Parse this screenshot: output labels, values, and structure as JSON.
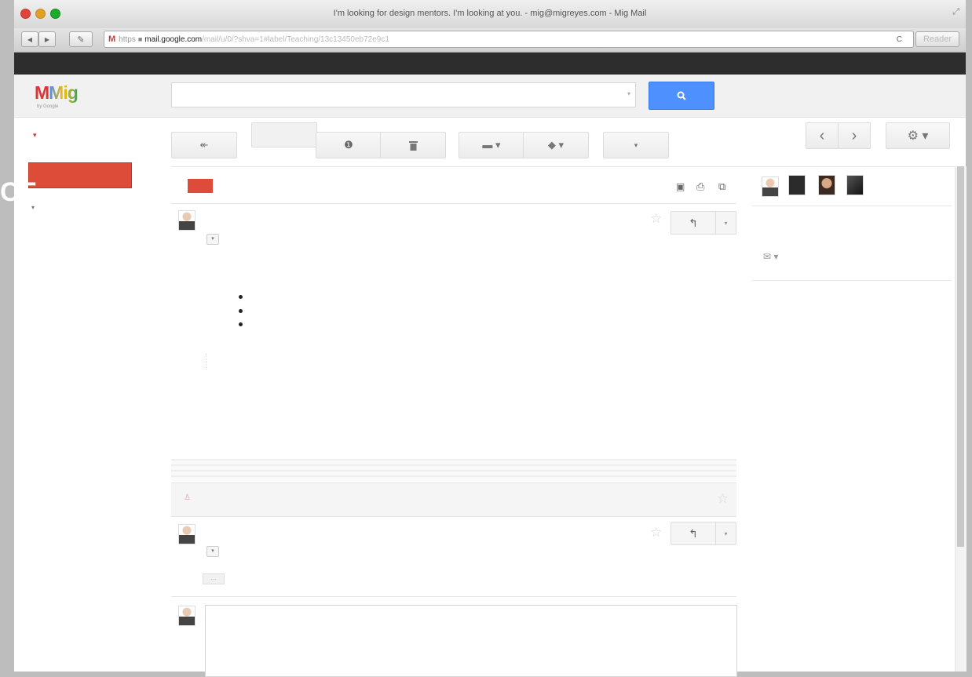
{
  "window": {
    "title": "I'm looking for design mentors. I'm looking at you. - mig@migreyes.com - Mig Mail",
    "traffic_colors": [
      "#e0443e",
      "#dea123",
      "#1aab29"
    ]
  },
  "browser": {
    "favicon": "M",
    "scheme": "https",
    "domain": "mail.google.com",
    "path": "/mail/u/0/?shva=1#label/Teaching/13c13450eb72e9c1",
    "reader_label": "Reader",
    "back_icon": "◀",
    "forward_icon": "▶",
    "wrench_icon": "🔧",
    "reload_icon": "C"
  },
  "gmail": {
    "logo_m": "M",
    "logo_name": "Mig",
    "logo_sub": "by Google",
    "accent": "#dd4b39",
    "search_icon": "🔍",
    "toolbar": {
      "back_icon": "↞",
      "spam_icon": "❶",
      "delete_icon": "🗑",
      "move_icon": "▬ ▾",
      "labels_icon": "◆ ▾",
      "more_icon": "▾",
      "prev_icon": "‹",
      "next_icon": "›",
      "settings_icon": "⚙ ▾"
    },
    "thread_icons": [
      "▣",
      "⎙",
      "⧉"
    ],
    "reply_icon": "↰",
    "dropdown_icon": "▾",
    "mail_icon": "✉ ▾",
    "collapsed_label": "...",
    "overlay_text": "CE"
  }
}
